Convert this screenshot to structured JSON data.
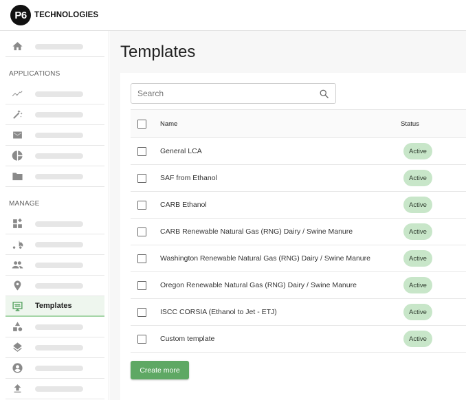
{
  "brand": {
    "logo_mark": "P6",
    "logo_text": "TECHNOLOGIES"
  },
  "sidebar": {
    "home": {
      "icon": "home-icon"
    },
    "sections": [
      {
        "label": "APPLICATIONS"
      },
      {
        "label": "MANAGE"
      }
    ],
    "applications": [
      {
        "icon": "trending-icon"
      },
      {
        "icon": "magic-wand-icon"
      },
      {
        "icon": "mail-icon"
      },
      {
        "icon": "pie-chart-icon"
      },
      {
        "icon": "folder-star-icon"
      }
    ],
    "manage": [
      {
        "icon": "widgets-icon"
      },
      {
        "icon": "truck-icon"
      },
      {
        "icon": "people-icon"
      },
      {
        "icon": "location-pin-icon"
      },
      {
        "icon": "templates-icon",
        "label": "Templates",
        "active": true
      },
      {
        "icon": "shapes-icon"
      },
      {
        "icon": "layers-icon"
      },
      {
        "icon": "account-circle-icon"
      },
      {
        "icon": "upload-icon"
      }
    ]
  },
  "main": {
    "title": "Templates",
    "search": {
      "placeholder": "Search",
      "value": ""
    },
    "table": {
      "headers": {
        "name": "Name",
        "status": "Status"
      },
      "rows": [
        {
          "name": "General LCA",
          "status": "Active"
        },
        {
          "name": "SAF from Ethanol",
          "status": "Active"
        },
        {
          "name": "CARB Ethanol",
          "status": "Active"
        },
        {
          "name": "CARB Renewable Natural Gas (RNG) Dairy / Swine Manure",
          "status": "Active"
        },
        {
          "name": "Washington Renewable Natural Gas (RNG) Dairy / Swine Manure",
          "status": "Active"
        },
        {
          "name": "Oregon Renewable Natural Gas (RNG) Dairy / Swine Manure",
          "status": "Active"
        },
        {
          "name": "ISCC CORSIA (Ethanol to Jet - ETJ)",
          "status": "Active"
        },
        {
          "name": "Custom template",
          "status": "Active"
        }
      ]
    },
    "create_button_label": "Create more"
  },
  "colors": {
    "accent": "#5ea864",
    "badge_bg": "#c8e6c9",
    "active_nav_bg": "#eef6ee"
  }
}
